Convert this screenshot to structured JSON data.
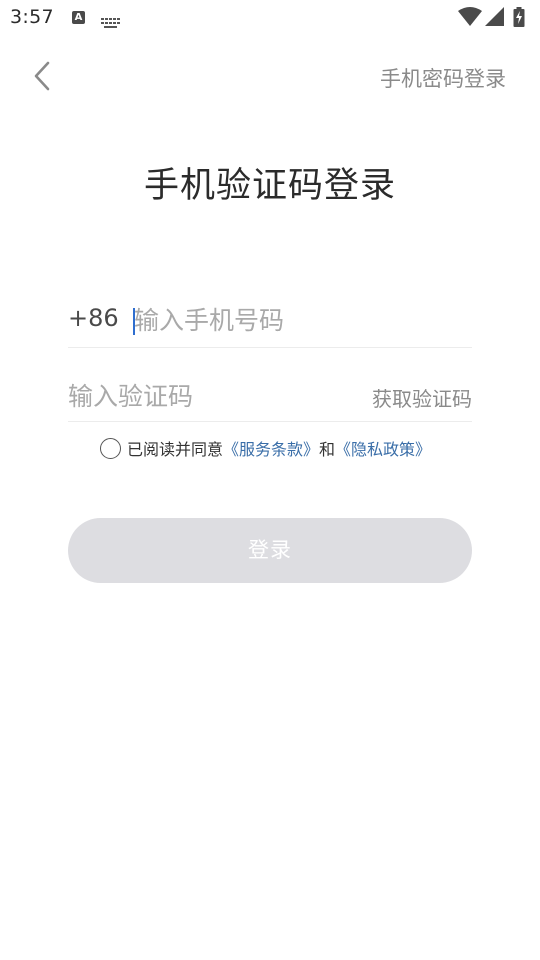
{
  "status_bar": {
    "time": "3:57",
    "icons": [
      "a-notification-icon",
      "keyboard-icon",
      "wifi-icon",
      "signal-icon",
      "battery-icon"
    ]
  },
  "header": {
    "back_icon": "chevron-left-icon",
    "alt_login_link": "手机密码登录"
  },
  "title": "手机验证码登录",
  "phone": {
    "country_code": "+86",
    "placeholder": "输入手机号码",
    "value": ""
  },
  "code": {
    "placeholder": "输入验证码",
    "value": "",
    "get_code_label": "获取验证码"
  },
  "agreement": {
    "checked": false,
    "prefix": "已阅读并同意",
    "terms_link": "《服务条款》",
    "conjunction": "和",
    "privacy_link": "《隐私政策》"
  },
  "login_button": {
    "label": "登录",
    "enabled": false
  },
  "colors": {
    "link": "#3a6ea8",
    "cursor": "#2f6ecf",
    "button_disabled_bg": "#dddde1",
    "divider": "#ececec"
  }
}
